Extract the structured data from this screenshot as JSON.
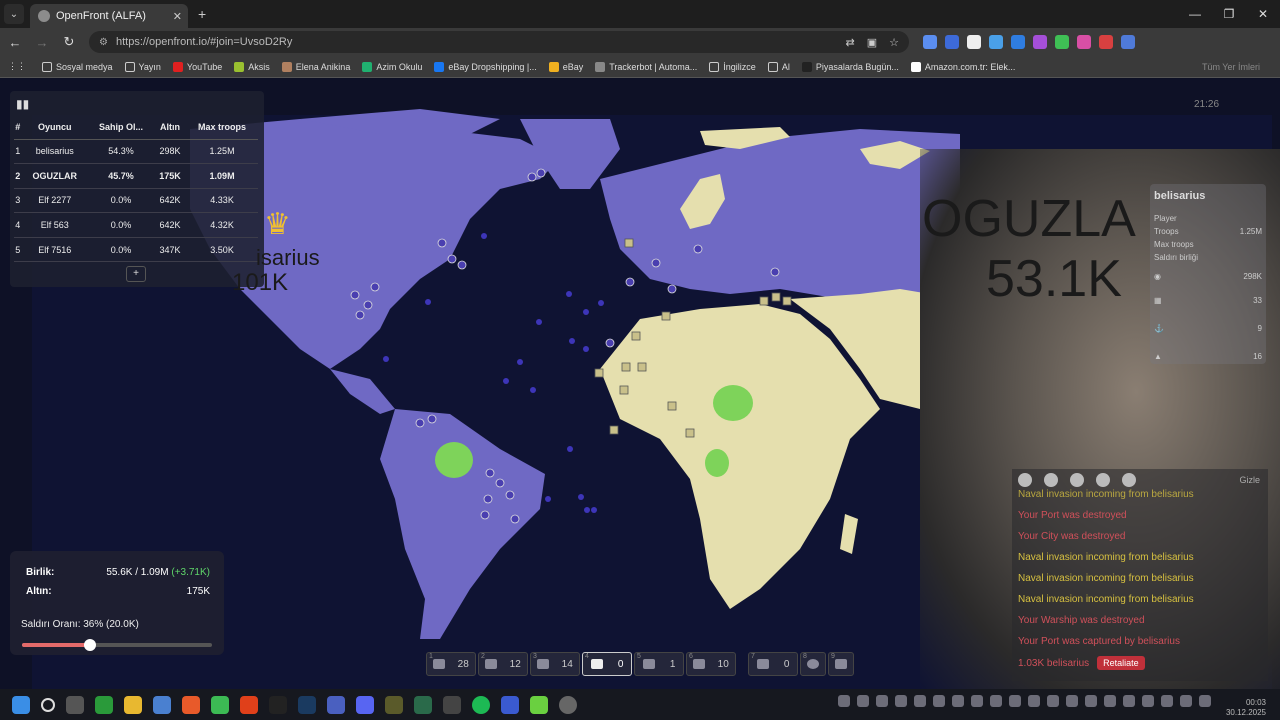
{
  "browser": {
    "tab_title": "OpenFront (ALFA)",
    "url": "https://openfront.io/#join=UvsoD2Ry",
    "bookmarks": [
      "Sosyal medya",
      "Yayın",
      "YouTube",
      "Aksis",
      "Elena Anikina",
      "Azim Okulu",
      "eBay Dropshipping |...",
      "eBay",
      "Trackerbot | Automa...",
      "İngilizce",
      "Al",
      "Piyasalarda Bugün...",
      "Amazon.com.tr: Elek...",
      "Tüm Yer İmleri"
    ]
  },
  "leaderboard": {
    "headers": [
      "#",
      "Oyuncu",
      "Sahip Ol...",
      "Altın",
      "Max troops"
    ],
    "rows": [
      {
        "rank": "1",
        "player": "belisarius",
        "owned": "54.3%",
        "gold": "298K",
        "troops": "1.25M"
      },
      {
        "rank": "2",
        "player": "OGUZLAR",
        "owned": "45.7%",
        "gold": "175K",
        "troops": "1.09M"
      },
      {
        "rank": "3",
        "player": "Elf 2277",
        "owned": "0.0%",
        "gold": "642K",
        "troops": "4.33K"
      },
      {
        "rank": "4",
        "player": "Elf 563",
        "owned": "0.0%",
        "gold": "642K",
        "troops": "4.32K"
      },
      {
        "rank": "5",
        "player": "Elf 7516",
        "owned": "0.0%",
        "gold": "347K",
        "troops": "3.50K"
      }
    ],
    "expand": "+"
  },
  "map": {
    "label_west_name": "isarius",
    "label_west_troops": "101K",
    "label_east_name": "OGUZLA",
    "label_east_troops": "53.1K"
  },
  "status": {
    "troops_label": "Birlik:",
    "troops_value": "55.6K / 1.09M",
    "troops_delta": "(+3.71K)",
    "gold_label": "Altın:",
    "gold_value": "175K",
    "attack_ratio": "Saldırı Oranı: 36% (20.0K)",
    "attack_ratio_fraction": 0.36
  },
  "buildbar": [
    {
      "key": "1",
      "count": "28",
      "icon": "city-icon"
    },
    {
      "key": "2",
      "count": "12",
      "icon": "factory-icon"
    },
    {
      "key": "3",
      "count": "14",
      "icon": "port-icon"
    },
    {
      "key": "4",
      "count": "0",
      "icon": "defense-post-icon"
    },
    {
      "key": "5",
      "count": "1",
      "icon": "missile-silo-icon"
    },
    {
      "key": "6",
      "count": "10",
      "icon": "sam-launcher-icon"
    },
    {
      "key": "7",
      "count": "0",
      "icon": "warship-icon"
    },
    {
      "key": "8",
      "count": "",
      "icon": "atom-bomb-icon"
    },
    {
      "key": "9",
      "count": "",
      "icon": "hydrogen-bomb-icon"
    }
  ],
  "player_panel": {
    "name": "belisarius",
    "rows": [
      "Player",
      "Troops",
      "Max troops",
      "Saldırı birliği"
    ],
    "gold": "298K",
    "counts": [
      "33",
      "9",
      "16"
    ],
    "troops_value": "1.25M"
  },
  "events": {
    "hide": "Gizle",
    "items": [
      {
        "text": "Naval invasion incoming from belisarius",
        "color": "gold"
      },
      {
        "text": "Your Port was destroyed",
        "color": "red"
      },
      {
        "text": "Your City was destroyed",
        "color": "red"
      },
      {
        "text": "Naval invasion incoming from belisarius",
        "color": "gold"
      },
      {
        "text": "Naval invasion incoming from belisarius",
        "color": "gold"
      },
      {
        "text": "Naval invasion incoming from belisarius",
        "color": "gold"
      },
      {
        "text": "Your Warship was destroyed",
        "color": "red"
      },
      {
        "text": "Your Port was captured by belisarius",
        "color": "red"
      },
      {
        "text": "1.03K belisarius",
        "color": "red"
      }
    ],
    "retaliate": "Retaliate"
  },
  "time": "21:26",
  "taskbar_clock": {
    "time": "00:03",
    "date": "30.12.2025"
  },
  "colors": {
    "blue_team": "#6f69c4",
    "tan_team": "#e5dfae",
    "ocean": "#0f1333",
    "green_zone": "#7ed35a"
  }
}
